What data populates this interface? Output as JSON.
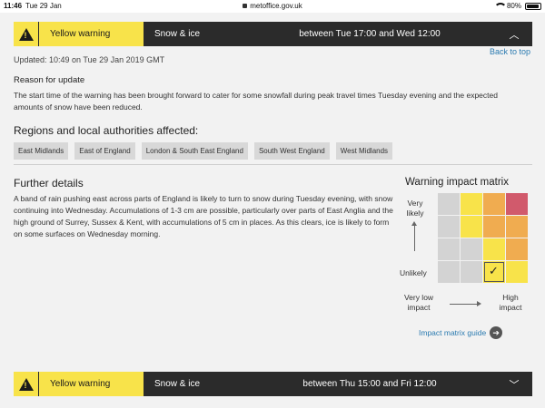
{
  "status_bar": {
    "time": "11:46",
    "date": "Tue 29 Jan",
    "url": "metoffice.gov.uk",
    "battery": "80%"
  },
  "warning_top": {
    "level": "Yellow warning",
    "type": "Snow & ice",
    "range": "between Tue 17:00 and Wed 12:00",
    "chevron": "︿",
    "color": "#f8e34a"
  },
  "updated": "Updated: 10:49 on Tue 29 Jan 2019 GMT",
  "back_to_top": "Back to top",
  "reason": {
    "heading": "Reason for update",
    "text": "The start time of the warning has been brought forward to cater for some snowfall during peak travel times Tuesday evening and the expected amounts of snow have been reduced."
  },
  "regions": {
    "heading": "Regions and local authorities affected:",
    "items": [
      "East Midlands",
      "East of England",
      "London & South East England",
      "South West England",
      "West Midlands"
    ]
  },
  "further": {
    "heading": "Further details",
    "text": "A band of rain pushing east across parts of England is likely to turn to snow during Tuesday evening, with snow continuing into Wednesday. Accumulations of 1-3 cm are possible, particularly over parts of East Anglia and the high ground of Surrey, Sussex & Kent, with accumulations of 5 cm in places. As this clears, ice is likely to form on some surfaces on Wednesday morning."
  },
  "matrix": {
    "heading": "Warning impact matrix",
    "very_likely": "Very likely",
    "unlikely": "Unlikely",
    "low_impact": "Very low impact",
    "high_impact": "High impact",
    "guide": "Impact matrix guide",
    "colors": {
      "grey": "#d3d3d3",
      "yellow": "#f8e34a",
      "amber": "#f0ac50",
      "red": "#d15a6c"
    },
    "rows": [
      [
        "grey",
        "yellow",
        "amber",
        "red"
      ],
      [
        "grey",
        "yellow",
        "amber",
        "amber"
      ],
      [
        "grey",
        "grey",
        "yellow",
        "amber"
      ],
      [
        "grey",
        "grey",
        "yellow",
        "yellow"
      ]
    ],
    "selected": {
      "row": 3,
      "col": 2
    }
  },
  "warning_bottom": {
    "level": "Yellow warning",
    "type": "Snow & ice",
    "range": "between Thu 15:00 and Fri 12:00",
    "chevron": "﹀"
  }
}
